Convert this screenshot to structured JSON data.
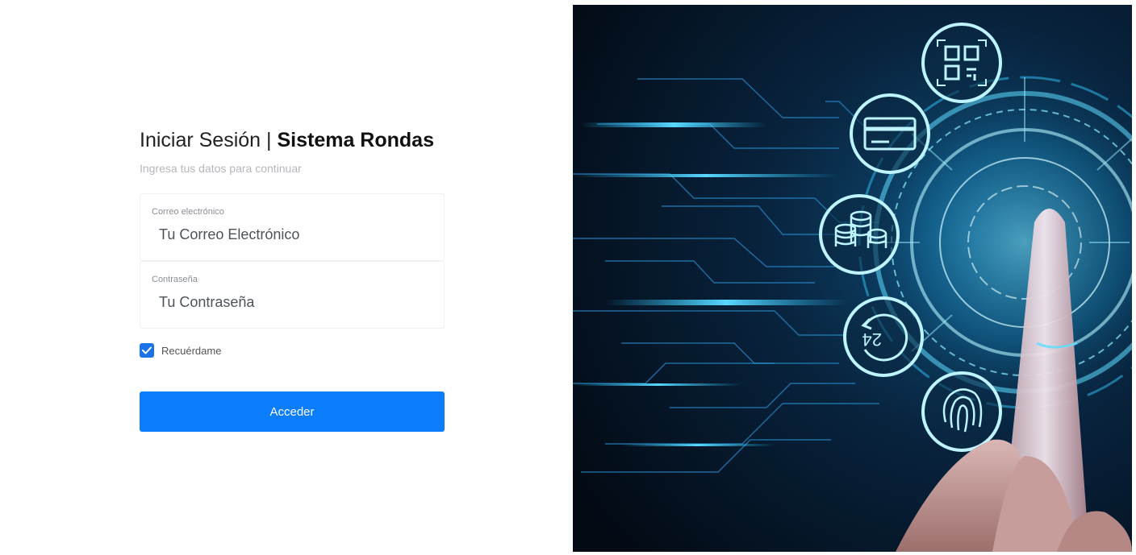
{
  "login": {
    "title_light": "Iniciar Sesión | ",
    "title_strong": "Sistema Rondas",
    "subtitle": "Ingresa tus datos para continuar",
    "email": {
      "label": "Correo electrónico",
      "placeholder": "Tu Correo Electrónico"
    },
    "password": {
      "label": "Contraseña",
      "placeholder": "Tu Contraseña"
    },
    "remember_label": "Recuérdame",
    "remember_checked": true,
    "submit_label": "Acceder"
  },
  "hero": {
    "icons": [
      "qr-code-icon",
      "credit-card-icon",
      "coins-icon",
      "clock-24-icon",
      "fingerprint-icon"
    ],
    "accent": "#27c4ff",
    "background": "#061424"
  }
}
